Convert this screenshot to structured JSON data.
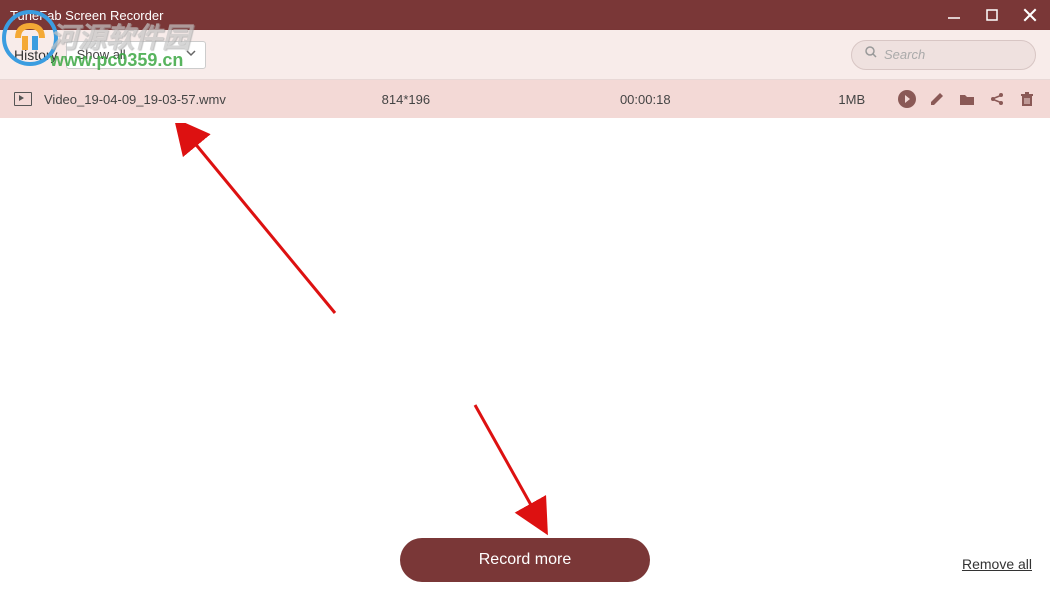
{
  "titlebar": {
    "title": "TuneFab Screen Recorder"
  },
  "toolbar": {
    "history_label": "History",
    "dropdown_selected": "Show all",
    "search_placeholder": "Search"
  },
  "row": {
    "filename": "Video_19-04-09_19-03-57.wmv",
    "dimensions": "814*196",
    "duration": "00:00:18",
    "filesize": "1MB"
  },
  "footer": {
    "record_more": "Record more",
    "remove_all": "Remove all"
  },
  "watermark": {
    "text": "河源软件园",
    "url": "www.pc0359.cn"
  }
}
